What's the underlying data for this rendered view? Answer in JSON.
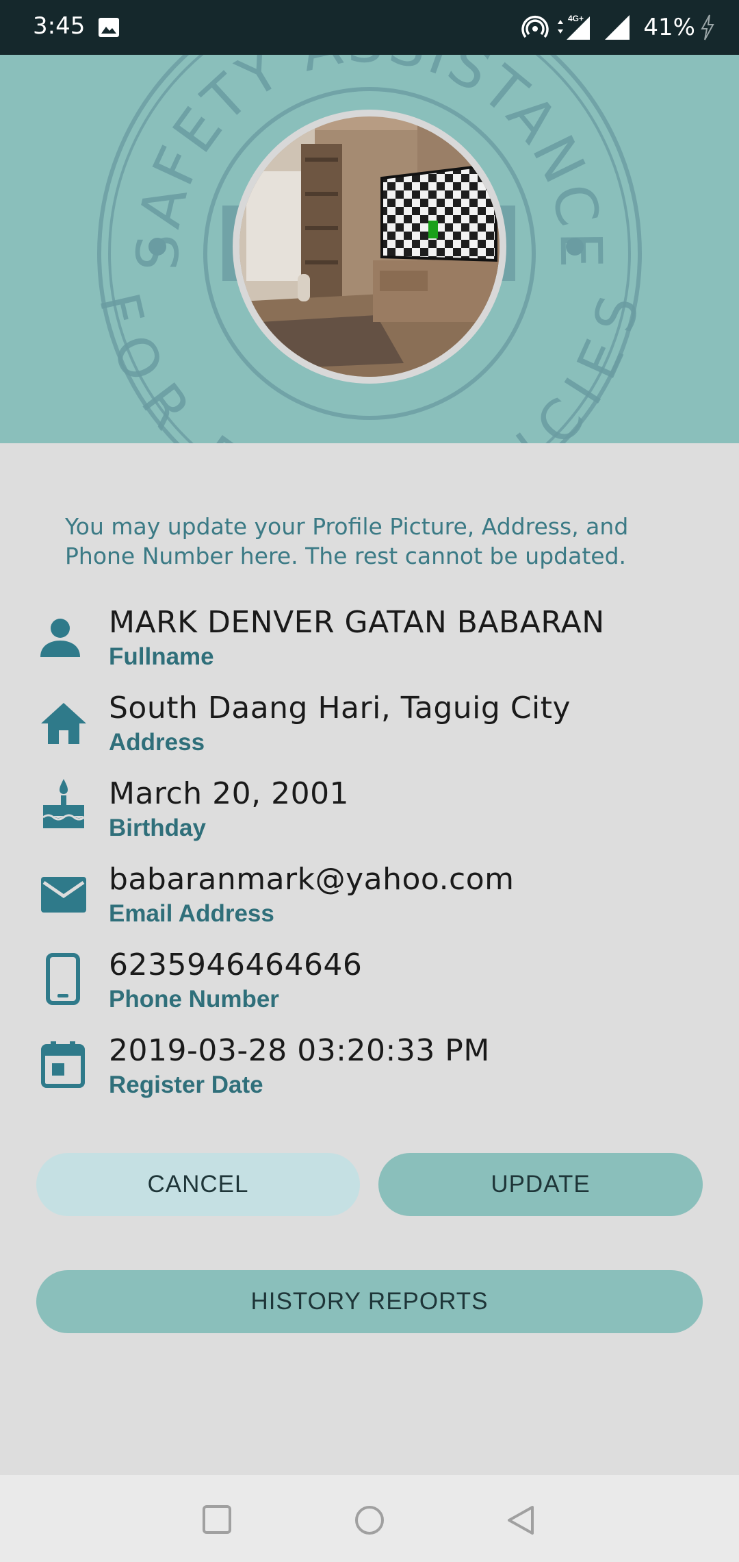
{
  "status_bar": {
    "time": "3:45",
    "network_type": "4G+",
    "battery": "41%",
    "icons": [
      "image-icon",
      "hotspot-icon",
      "signal-4g-icon",
      "signal-icon",
      "battery-charging-icon"
    ]
  },
  "header": {
    "seal_text_top": "SAFETY ASSISTANCE",
    "seal_text_bottom": "FOR EMERGENCIES",
    "background_color": "#8abfbb"
  },
  "notice": "You may update your Profile Picture, Address, and Phone Number here. The rest cannot be updated.",
  "profile": {
    "fullname": {
      "value": "MARK DENVER GATAN BABARAN",
      "label": "Fullname",
      "icon": "person-icon"
    },
    "address": {
      "value": "South Daang Hari, Taguig City",
      "label": "Address",
      "icon": "home-icon"
    },
    "birthday": {
      "value": "March 20, 2001",
      "label": "Birthday",
      "icon": "cake-icon"
    },
    "email": {
      "value": "babaranmark@yahoo.com",
      "label": "Email Address",
      "icon": "mail-icon"
    },
    "phone": {
      "value": "6235946464646",
      "label": "Phone Number",
      "icon": "phone-icon"
    },
    "register_date": {
      "value": "2019-03-28 03:20:33 PM",
      "label": "Register Date",
      "icon": "calendar-icon"
    }
  },
  "buttons": {
    "cancel": "CANCEL",
    "update": "UPDATE",
    "history": "HISTORY REPORTS"
  },
  "colors": {
    "accent": "#3b7a85",
    "label": "#2f6f7a",
    "button_primary": "#8abfbb",
    "button_secondary": "#c5e0e3",
    "status_bar": "#15282c"
  }
}
